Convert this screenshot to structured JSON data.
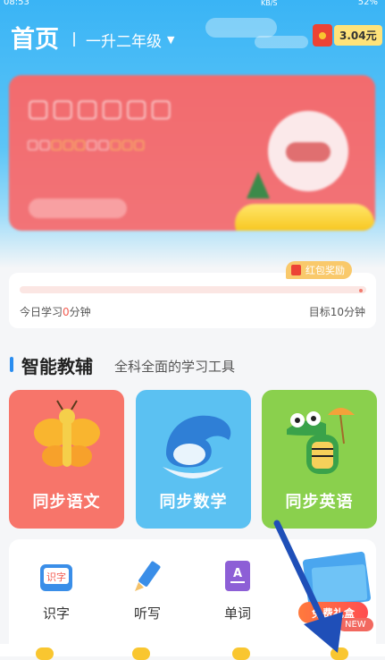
{
  "status_bar": {
    "time": "08:53",
    "speed": "KB/S",
    "battery": "52%"
  },
  "header": {
    "title": "首页",
    "grade": "一升二年级",
    "red_envelope_amount": "3.04元"
  },
  "progress": {
    "badge": "红包奖励",
    "today_prefix": "今日学习",
    "today_minutes": "0",
    "today_suffix": "分钟",
    "goal": "目标10分钟",
    "fraction": 0.0
  },
  "section": {
    "title": "智能教辅",
    "subtitle": "全科全面的学习工具"
  },
  "subject_cards": [
    {
      "label": "同步语文",
      "color": "#f7756a"
    },
    {
      "label": "同步数学",
      "color": "#5bc1f2"
    },
    {
      "label": "同步英语",
      "color": "#8ad04d"
    }
  ],
  "tools": [
    {
      "label": "识字",
      "icon": "shizi-card-icon",
      "icon_text": "识字"
    },
    {
      "label": "听写",
      "icon": "pencil-icon"
    },
    {
      "label": "单词",
      "icon": "word-book-icon",
      "icon_text": "A"
    }
  ],
  "gift": {
    "label": "免费礼盒",
    "badge": "NEW"
  },
  "colors": {
    "accent": "#2a8df0",
    "header_blue": "#3ab4f5",
    "red": "#ec4335",
    "yellow": "#ffe37a"
  }
}
